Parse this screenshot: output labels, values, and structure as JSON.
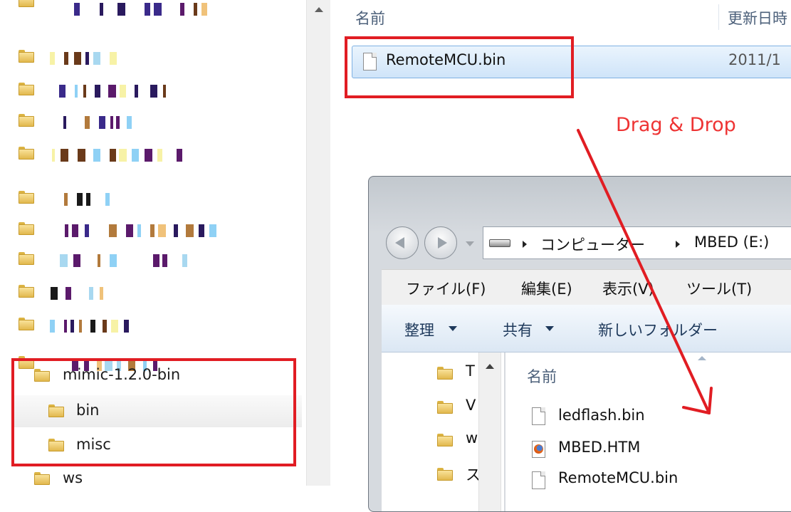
{
  "tree": {
    "folders": [
      {
        "label": "mimic-1.2.0-bin"
      },
      {
        "label": "bin"
      },
      {
        "label": "misc"
      },
      {
        "label": "ws"
      }
    ]
  },
  "file_list": {
    "columns": {
      "name": "名前",
      "date": "更新日時"
    },
    "selected_file": {
      "name": "RemoteMCU.bin",
      "date": "2011/1"
    }
  },
  "annotation": {
    "text": "Drag & Drop",
    "color": "#ee3333",
    "box_color": "#e11d23"
  },
  "window": {
    "breadcrumbs": [
      "コンピューター",
      "MBED (E:)"
    ],
    "menu": [
      "ファイル(F)",
      "編集(E)",
      "表示(V)",
      "ツール(T)"
    ],
    "toolbar": [
      "整理",
      "共有",
      "新しいフォルダー"
    ],
    "nav_items": [
      "T",
      "V",
      "w",
      "ス"
    ],
    "list_header": "名前",
    "files": [
      {
        "name": "ledflash.bin",
        "icon": "document-icon"
      },
      {
        "name": "MBED.HTM",
        "icon": "firefox-html-icon"
      },
      {
        "name": "RemoteMCU.bin",
        "icon": "document-icon"
      }
    ]
  }
}
